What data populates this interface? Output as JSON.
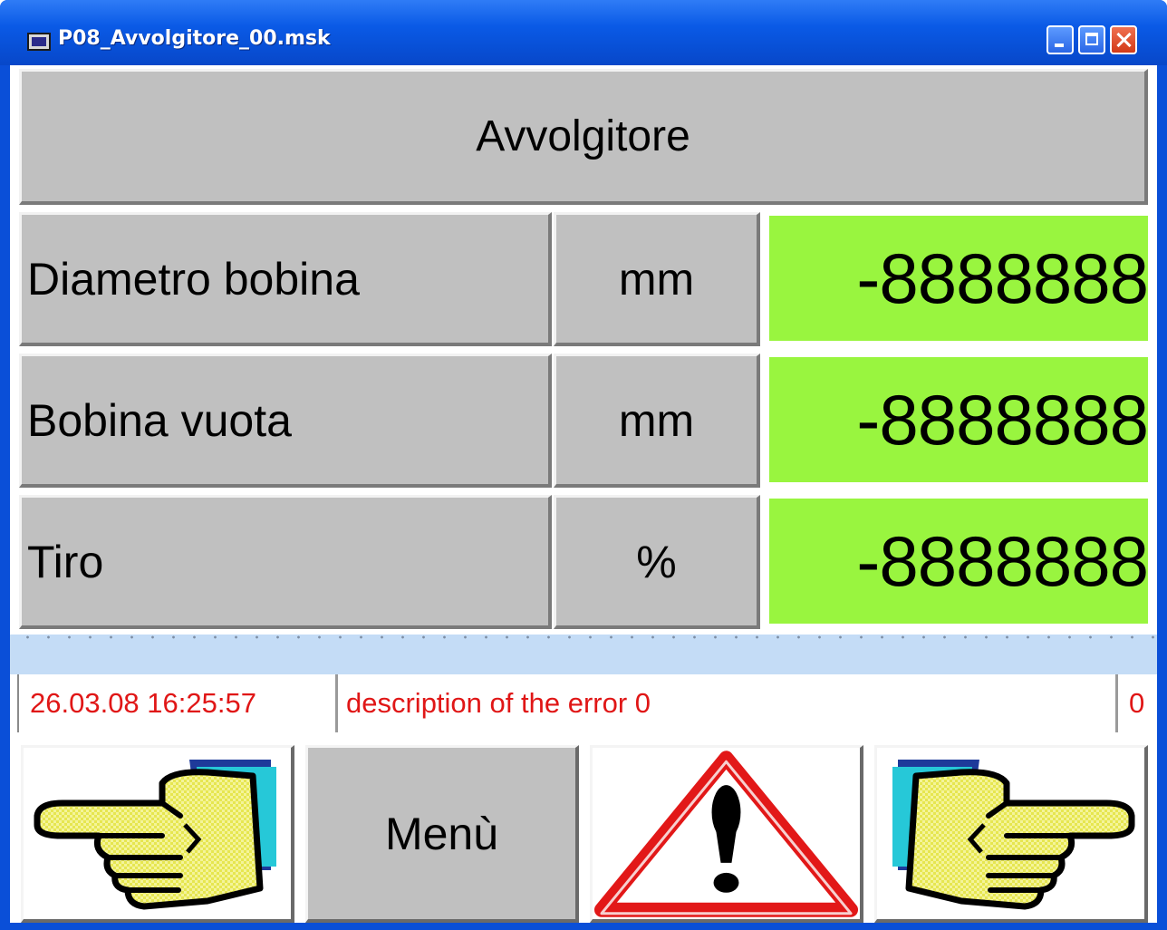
{
  "window": {
    "title": "P08_Avvolgitore_00.msk"
  },
  "header": {
    "title": "Avvolgitore"
  },
  "rows": [
    {
      "label": "Diametro bobina",
      "unit": "mm",
      "value": "-8888888"
    },
    {
      "label": "Bobina vuota",
      "unit": "mm",
      "value": "-8888888"
    },
    {
      "label": "Tiro",
      "unit": "%",
      "value": "-8888888"
    }
  ],
  "alarm": {
    "timestamp": "26.03.08 16:25:57",
    "description": "description of the error 0",
    "code": "0"
  },
  "buttons": {
    "prev_icon": "hand-pointing-left-icon",
    "menu_label": "Menù",
    "alarm_icon": "warning-triangle-icon",
    "next_icon": "hand-pointing-right-icon"
  },
  "colors": {
    "value_background": "#99f53f",
    "panel_gray": "#c0c0c0",
    "alarm_text": "#e01616",
    "titlebar": "#0a5ae6"
  }
}
